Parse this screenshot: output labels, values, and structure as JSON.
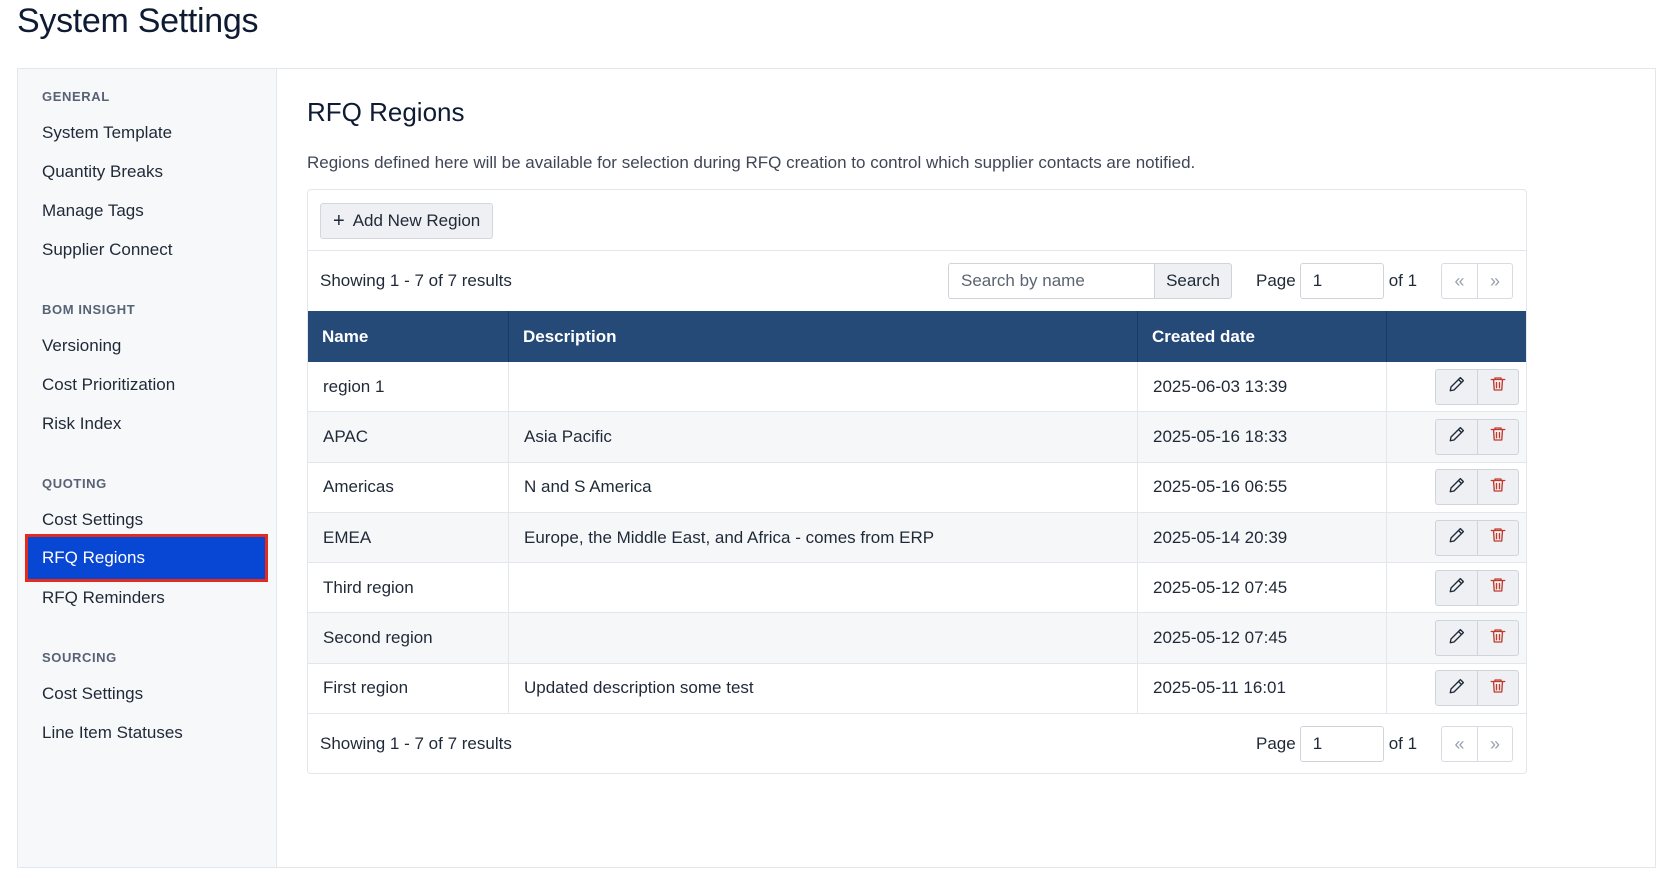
{
  "page_title": "System Settings",
  "sidebar": {
    "sections": [
      {
        "title": "GENERAL",
        "items": [
          "System Template",
          "Quantity Breaks",
          "Manage Tags",
          "Supplier Connect"
        ]
      },
      {
        "title": "BOM INSIGHT",
        "items": [
          "Versioning",
          "Cost Prioritization",
          "Risk Index"
        ]
      },
      {
        "title": "QUOTING",
        "items": [
          "Cost Settings",
          "RFQ Regions",
          "RFQ Reminders"
        ]
      },
      {
        "title": "SOURCING",
        "items": [
          "Cost Settings",
          "Line Item Statuses"
        ]
      }
    ],
    "active_item": "RFQ Regions"
  },
  "main": {
    "title": "RFQ Regions",
    "description": "Regions defined here will be available for selection during RFQ creation to control which supplier contacts are notified.",
    "add_button": {
      "icon": "plus-icon",
      "label": "Add New Region"
    },
    "results_text": "Showing 1 - 7 of 7 results",
    "search": {
      "placeholder": "Search by name",
      "button_label": "Search"
    },
    "pager": {
      "page_label": "Page",
      "page_value": "1",
      "of_label": "of 1",
      "first": "«",
      "last": "»"
    },
    "table": {
      "columns": [
        "Name",
        "Description",
        "Created date",
        ""
      ],
      "rows": [
        {
          "name": "region 1",
          "description": "",
          "created": "2025-06-03 13:39"
        },
        {
          "name": "APAC",
          "description": "Asia Pacific",
          "created": "2025-05-16 18:33"
        },
        {
          "name": "Americas",
          "description": "N and S America",
          "created": "2025-05-16 06:55"
        },
        {
          "name": "EMEA",
          "description": "Europe, the Middle East, and Africa - comes from ERP",
          "created": "2025-05-14 20:39"
        },
        {
          "name": "Third region",
          "description": "",
          "created": "2025-05-12 07:45"
        },
        {
          "name": "Second region",
          "description": "",
          "created": "2025-05-12 07:45"
        },
        {
          "name": "First region",
          "description": "Updated description some test",
          "created": "2025-05-11 16:01"
        }
      ],
      "row_actions": [
        "pencil-icon",
        "trash-icon"
      ]
    }
  },
  "colors": {
    "header_bg": "#264a78",
    "active_nav": "#0747d4",
    "highlight_outline": "#e32b1e",
    "delete_icon": "#c0392b"
  }
}
